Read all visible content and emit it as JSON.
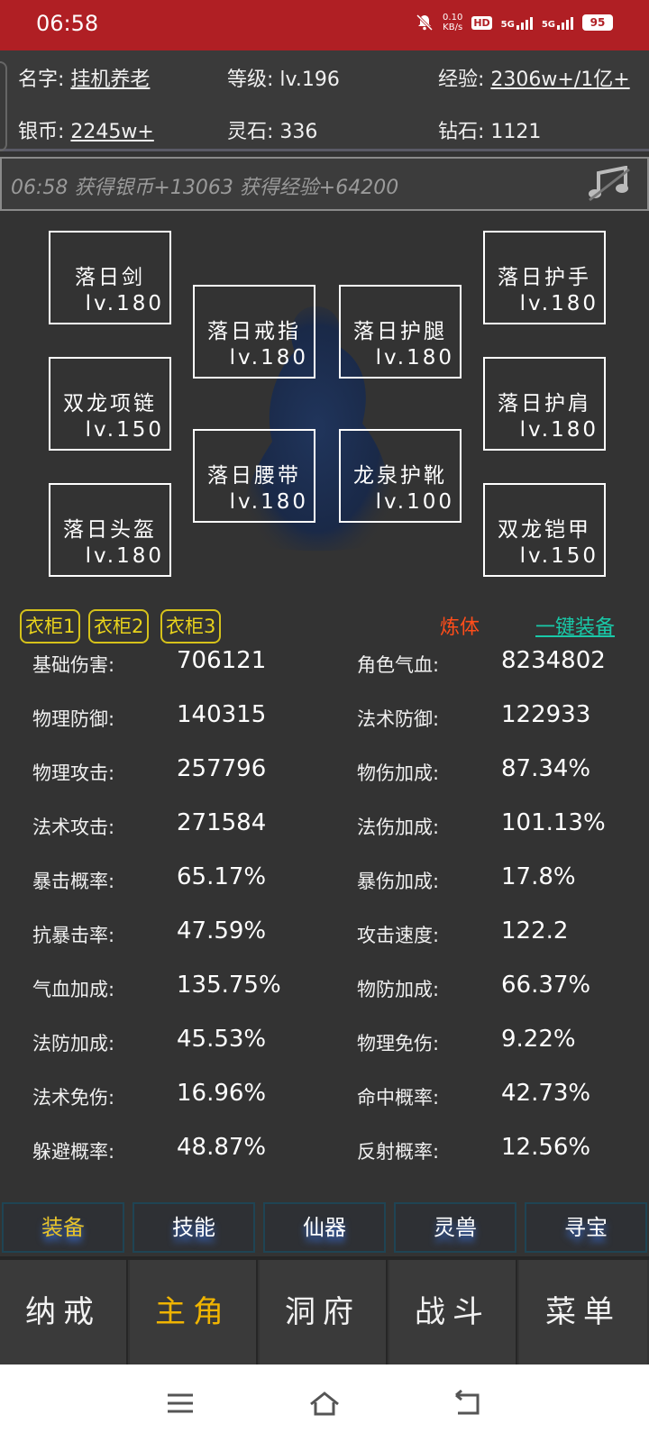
{
  "status_bar": {
    "time": "06:58",
    "net_speed_value": "0.10",
    "net_speed_unit": "KB/s",
    "hd_label": "HD",
    "network_1": "5G",
    "network_2": "5G",
    "battery": "95"
  },
  "player": {
    "name_label": "名字: ",
    "name_value": "挂机养老",
    "level_label": "等级: ",
    "level_value": "lv.196",
    "exp_label": "经验: ",
    "exp_value": "2306w+/1亿+",
    "silver_label": "银币: ",
    "silver_value": "2245w+",
    "spirit_stone_label": "灵石: ",
    "spirit_stone_value": "336",
    "diamond_label": "钻石: ",
    "diamond_value": "1121"
  },
  "log": {
    "text": "06:58 获得银币+13063 获得经验+64200"
  },
  "equipment": [
    {
      "name": "落日剑",
      "level": "lv.180",
      "color": "#e01818"
    },
    {
      "name": "落日护手",
      "level": "lv.180",
      "color": "#e01818"
    },
    {
      "name": "落日戒指",
      "level": "lv.180",
      "color": "#3a6fd8"
    },
    {
      "name": "落日护腿",
      "level": "lv.180",
      "color": "#3a6fd8"
    },
    {
      "name": "双龙项链",
      "level": "lv.150",
      "color": "#e01818"
    },
    {
      "name": "落日护肩",
      "level": "lv.180",
      "color": "#e01818"
    },
    {
      "name": "落日腰带",
      "level": "lv.180",
      "color": "#3a6fd8"
    },
    {
      "name": "龙泉护靴",
      "level": "lv.100",
      "color": "#e01818"
    },
    {
      "name": "落日头盔",
      "level": "lv.180",
      "color": "#3a6fd8"
    },
    {
      "name": "双龙铠甲",
      "level": "lv.150",
      "color": "#e01818"
    }
  ],
  "wardrobes": [
    "衣柜1",
    "衣柜2",
    "衣柜3"
  ],
  "actions": {
    "refine_label": "炼体",
    "equip_all_label": "一键装备"
  },
  "stats": [
    {
      "label": "基础伤害:",
      "value": "706121"
    },
    {
      "label": "角色气血:",
      "value": "8234802"
    },
    {
      "label": "物理防御:",
      "value": "140315"
    },
    {
      "label": "法术防御:",
      "value": "122933"
    },
    {
      "label": "物理攻击:",
      "value": "257796"
    },
    {
      "label": "物伤加成:",
      "value": "87.34%"
    },
    {
      "label": "法术攻击:",
      "value": "271584"
    },
    {
      "label": "法伤加成:",
      "value": "101.13%"
    },
    {
      "label": "暴击概率:",
      "value": "65.17%"
    },
    {
      "label": "暴伤加成:",
      "value": "17.8%"
    },
    {
      "label": "抗暴击率:",
      "value": "47.59%"
    },
    {
      "label": "攻击速度:",
      "value": "122.2"
    },
    {
      "label": "气血加成:",
      "value": "135.75%"
    },
    {
      "label": "物防加成:",
      "value": "66.37%"
    },
    {
      "label": "法防加成:",
      "value": "45.53%"
    },
    {
      "label": "物理免伤:",
      "value": "9.22%"
    },
    {
      "label": "法术免伤:",
      "value": "16.96%"
    },
    {
      "label": "命中概率:",
      "value": "42.73%"
    },
    {
      "label": "躲避概率:",
      "value": "48.87%"
    },
    {
      "label": "反射概率:",
      "value": "12.56%"
    }
  ],
  "function_tabs": [
    "装备",
    "技能",
    "仙器",
    "灵兽",
    "寻宝"
  ],
  "bottom_nav": [
    "纳戒",
    "主角",
    "洞府",
    "战斗",
    "菜单"
  ],
  "colors": {
    "status_bar": "#b01f24",
    "active_tab": "#e6c22a",
    "active_nav": "#f0b400",
    "refine": "#ff4d1a",
    "equip_all": "#19c9a8"
  },
  "icons": {
    "mute": "bell-off-icon",
    "music": "music-note-icon",
    "nav_menu": "menu-icon",
    "nav_home": "home-icon",
    "nav_back": "back-icon"
  }
}
